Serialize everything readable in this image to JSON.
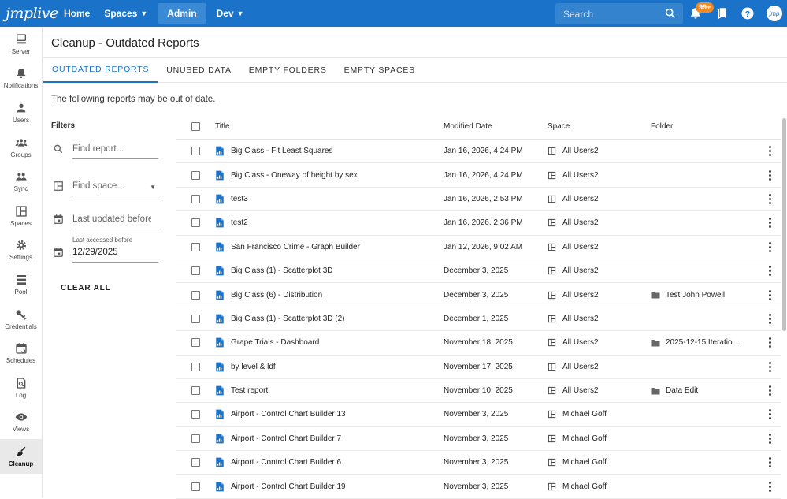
{
  "topbar": {
    "logo": "jmplive",
    "nav": [
      {
        "label": "Home",
        "caret": false,
        "active": false
      },
      {
        "label": "Spaces",
        "caret": true,
        "active": false
      },
      {
        "label": "Admin",
        "caret": false,
        "active": true
      },
      {
        "label": "Dev",
        "caret": true,
        "active": false
      }
    ],
    "search_placeholder": "Search",
    "notification_badge": "99+",
    "avatar_label": "jmp"
  },
  "sidebar": {
    "items": [
      {
        "label": "Server",
        "icon": "server-icon"
      },
      {
        "label": "Notifications",
        "icon": "bell-icon"
      },
      {
        "label": "Users",
        "icon": "user-icon"
      },
      {
        "label": "Groups",
        "icon": "groups-icon"
      },
      {
        "label": "Sync",
        "icon": "sync-icon"
      },
      {
        "label": "Spaces",
        "icon": "spaces-icon"
      },
      {
        "label": "Settings",
        "icon": "gear-icon"
      },
      {
        "label": "Pool",
        "icon": "pool-icon"
      },
      {
        "label": "Credentials",
        "icon": "key-icon"
      },
      {
        "label": "Schedules",
        "icon": "calendar-icon"
      },
      {
        "label": "Log",
        "icon": "log-icon"
      },
      {
        "label": "Views",
        "icon": "eye-icon"
      },
      {
        "label": "Cleanup",
        "icon": "broom-icon",
        "active": true
      }
    ]
  },
  "page": {
    "title": "Cleanup - Outdated Reports",
    "tabs": [
      {
        "label": "OUTDATED REPORTS",
        "active": true
      },
      {
        "label": "UNUSED DATA",
        "active": false
      },
      {
        "label": "EMPTY FOLDERS",
        "active": false
      },
      {
        "label": "EMPTY SPACES",
        "active": false
      }
    ],
    "subtitle": "The following reports may be out of date."
  },
  "filters": {
    "label": "Filters",
    "find_report_placeholder": "Find report...",
    "find_space_placeholder": "Find space...",
    "last_updated_placeholder": "Last updated before",
    "last_accessed_label": "Last accessed before",
    "last_accessed_value": "12/29/2025",
    "clear_all": "CLEAR ALL"
  },
  "table": {
    "columns": {
      "title": "Title",
      "modified": "Modified Date",
      "space": "Space",
      "folder": "Folder"
    },
    "rows": [
      {
        "title": "Big Class - Fit Least Squares",
        "modified": "Jan 16, 2026, 4:24 PM",
        "space": "All Users2",
        "folder": ""
      },
      {
        "title": "Big Class - Oneway of height by sex",
        "modified": "Jan 16, 2026, 4:24 PM",
        "space": "All Users2",
        "folder": ""
      },
      {
        "title": "test3",
        "modified": "Jan 16, 2026, 2:53 PM",
        "space": "All Users2",
        "folder": ""
      },
      {
        "title": "test2",
        "modified": "Jan 16, 2026, 2:36 PM",
        "space": "All Users2",
        "folder": ""
      },
      {
        "title": "San Francisco Crime - Graph Builder",
        "modified": "Jan 12, 2026, 9:02 AM",
        "space": "All Users2",
        "folder": ""
      },
      {
        "title": "Big Class (1) - Scatterplot 3D",
        "modified": "December 3, 2025",
        "space": "All Users2",
        "folder": ""
      },
      {
        "title": "Big Class (6) - Distribution",
        "modified": "December 3, 2025",
        "space": "All Users2",
        "folder": "Test John Powell"
      },
      {
        "title": "Big Class (1) - Scatterplot 3D (2)",
        "modified": "December 1, 2025",
        "space": "All Users2",
        "folder": ""
      },
      {
        "title": "Grape Trials - Dashboard",
        "modified": "November 18, 2025",
        "space": "All Users2",
        "folder": "2025-12-15 Iteratio..."
      },
      {
        "title": "by level & ldf",
        "modified": "November 17, 2025",
        "space": "All Users2",
        "folder": ""
      },
      {
        "title": "Test report",
        "modified": "November 10, 2025",
        "space": "All Users2",
        "folder": "Data Edit"
      },
      {
        "title": "Airport - Control Chart Builder 13",
        "modified": "November 3, 2025",
        "space": "Michael Goff",
        "folder": ""
      },
      {
        "title": "Airport - Control Chart Builder 7",
        "modified": "November 3, 2025",
        "space": "Michael Goff",
        "folder": ""
      },
      {
        "title": "Airport - Control Chart Builder 6",
        "modified": "November 3, 2025",
        "space": "Michael Goff",
        "folder": ""
      },
      {
        "title": "Airport - Control Chart Builder 19",
        "modified": "November 3, 2025",
        "space": "Michael Goff",
        "folder": ""
      }
    ]
  }
}
